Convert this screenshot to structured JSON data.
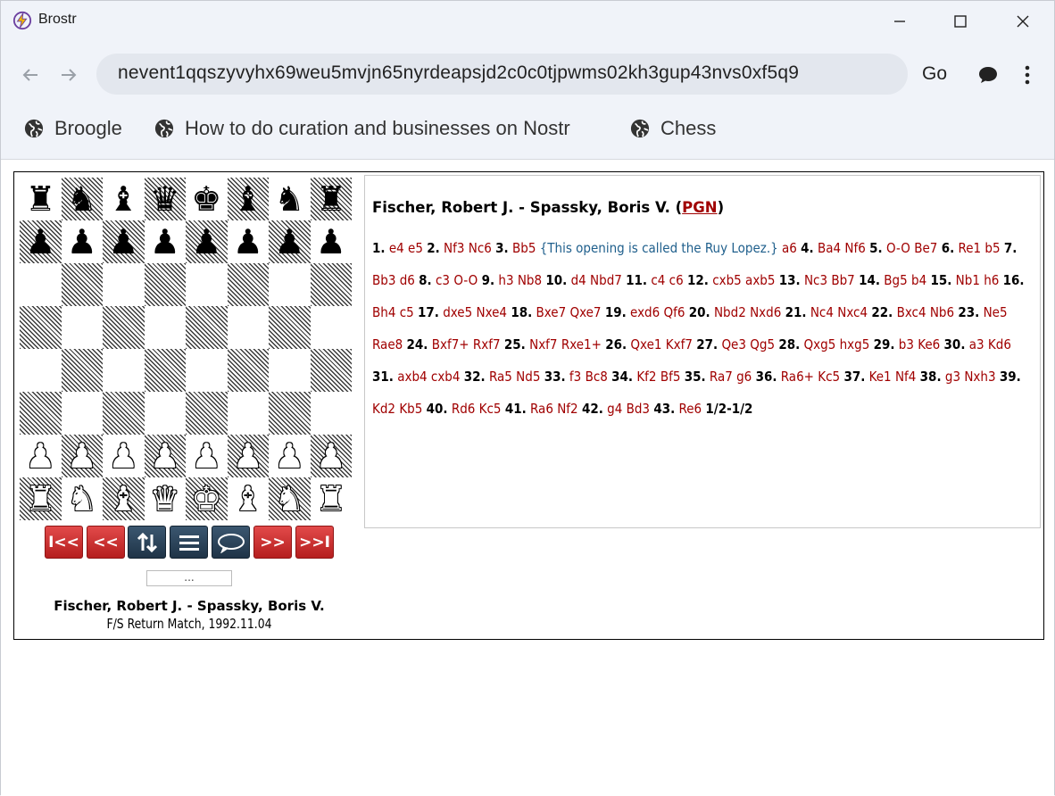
{
  "window": {
    "title": "Brostr"
  },
  "toolbar": {
    "url": "nevent1qqszyvyhx69weu5mvjn65nyrdeapsjd2c0c0tjpwms02kh3gup43nvs0xf5q9",
    "go_label": "Go"
  },
  "bookmarks": [
    {
      "label": "Broogle"
    },
    {
      "label": "How to do curation and businesses on Nostr"
    },
    {
      "label": "Chess"
    }
  ],
  "board": {
    "ranks": [
      [
        "bR",
        "bN",
        "bB",
        "bQ",
        "bK",
        "bB",
        "bN",
        "bR"
      ],
      [
        "bP",
        "bP",
        "bP",
        "bP",
        "bP",
        "bP",
        "bP",
        "bP"
      ],
      [
        "",
        "",
        "",
        "",
        "",
        "",
        "",
        ""
      ],
      [
        "",
        "",
        "",
        "",
        "",
        "",
        "",
        ""
      ],
      [
        "",
        "",
        "",
        "",
        "",
        "",
        "",
        ""
      ],
      [
        "",
        "",
        "",
        "",
        "",
        "",
        "",
        ""
      ],
      [
        "wP",
        "wP",
        "wP",
        "wP",
        "wP",
        "wP",
        "wP",
        "wP"
      ],
      [
        "wR",
        "wN",
        "wB",
        "wQ",
        "wK",
        "wB",
        "wN",
        "wR"
      ]
    ]
  },
  "controls": {
    "first": "I<<",
    "back": "<<",
    "flip": "flip-icon",
    "menu": "menu-icon",
    "comment": "comment-icon",
    "forward": ">>",
    "last": ">>I",
    "colors": {
      "red": "#c62828",
      "navy": "#2a4358"
    }
  },
  "game": {
    "move_indicator": "...",
    "players": "Fischer, Robert J. - Spassky, Boris V.",
    "event": "F/S Return Match, 1992.11.04",
    "header_players": "Fischer, Robert J. - Spassky, Boris V. (",
    "pgn_link": "PGN",
    "header_close": ")",
    "result": "1/2-1/2",
    "moves": [
      [
        "1.",
        "e4",
        "e5"
      ],
      [
        "2.",
        "Nf3",
        "Nc6"
      ],
      [
        "3.",
        "Bb5",
        "{This opening is called the Ruy Lopez.}",
        "a6"
      ],
      [
        "4.",
        "Ba4",
        "Nf6"
      ],
      [
        "5.",
        "O-O",
        "Be7"
      ],
      [
        "6.",
        "Re1",
        "b5"
      ],
      [
        "7.",
        "Bb3",
        "d6"
      ],
      [
        "8.",
        "c3",
        "O-O"
      ],
      [
        "9.",
        "h3",
        "Nb8"
      ],
      [
        "10.",
        "d4",
        "Nbd7"
      ],
      [
        "11.",
        "c4",
        "c6"
      ],
      [
        "12.",
        "cxb5",
        "axb5"
      ],
      [
        "13.",
        "Nc3",
        "Bb7"
      ],
      [
        "14.",
        "Bg5",
        "b4"
      ],
      [
        "15.",
        "Nb1",
        "h6"
      ],
      [
        "16.",
        "Bh4",
        "c5"
      ],
      [
        "17.",
        "dxe5",
        "Nxe4"
      ],
      [
        "18.",
        "Bxe7",
        "Qxe7"
      ],
      [
        "19.",
        "exd6",
        "Qf6"
      ],
      [
        "20.",
        "Nbd2",
        "Nxd6"
      ],
      [
        "21.",
        "Nc4",
        "Nxc4"
      ],
      [
        "22.",
        "Bxc4",
        "Nb6"
      ],
      [
        "23.",
        "Ne5",
        "Rae8"
      ],
      [
        "24.",
        "Bxf7+",
        "Rxf7"
      ],
      [
        "25.",
        "Nxf7",
        "Rxe1+"
      ],
      [
        "26.",
        "Qxe1",
        "Kxf7"
      ],
      [
        "27.",
        "Qe3",
        "Qg5"
      ],
      [
        "28.",
        "Qxg5",
        "hxg5"
      ],
      [
        "29.",
        "b3",
        "Ke6"
      ],
      [
        "30.",
        "a3",
        "Kd6"
      ],
      [
        "31.",
        "axb4",
        "cxb4"
      ],
      [
        "32.",
        "Ra5",
        "Nd5"
      ],
      [
        "33.",
        "f3",
        "Bc8"
      ],
      [
        "34.",
        "Kf2",
        "Bf5"
      ],
      [
        "35.",
        "Ra7",
        "g6"
      ],
      [
        "36.",
        "Ra6+",
        "Kc5"
      ],
      [
        "37.",
        "Ke1",
        "Nf4"
      ],
      [
        "38.",
        "g3",
        "Nxh3"
      ],
      [
        "39.",
        "Kd2",
        "Kb5"
      ],
      [
        "40.",
        "Rd6",
        "Kc5"
      ],
      [
        "41.",
        "Ra6",
        "Nf2"
      ],
      [
        "42.",
        "g4",
        "Bd3"
      ],
      [
        "43.",
        "Re6"
      ]
    ]
  }
}
